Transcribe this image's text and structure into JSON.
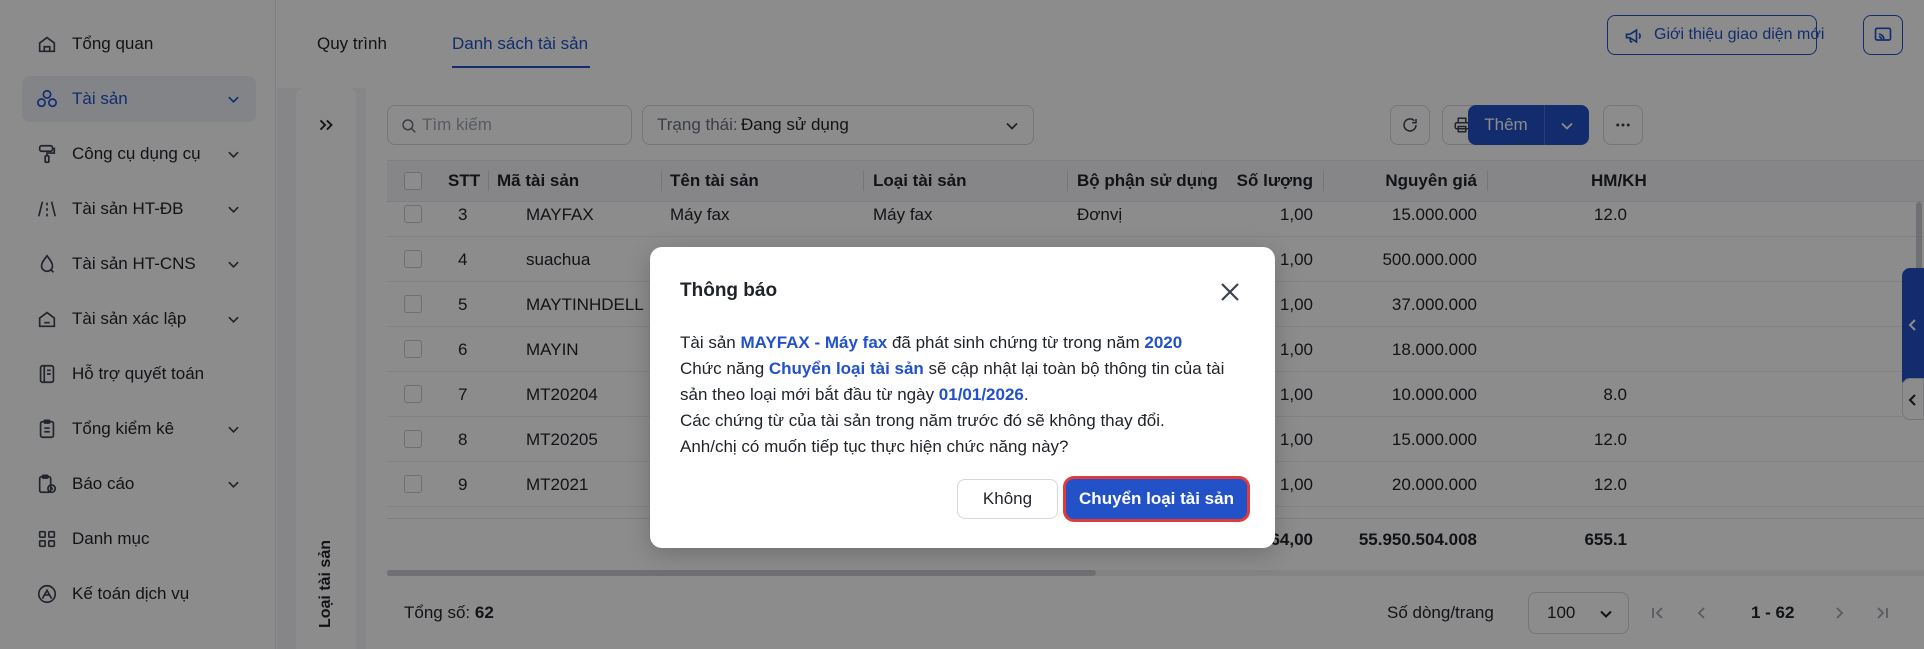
{
  "sidebar": {
    "items": [
      {
        "label": "Tổng quan",
        "icon": "home-icon",
        "has_chevron": false,
        "active": false
      },
      {
        "label": "Tài sản",
        "icon": "assets-icon",
        "has_chevron": true,
        "active": true
      },
      {
        "label": "Công cụ dụng cụ",
        "icon": "paint-roller-icon",
        "has_chevron": true,
        "active": false
      },
      {
        "label": "Tài sản HT-ĐB",
        "icon": "road-icon",
        "has_chevron": true,
        "active": false
      },
      {
        "label": "Tài sản HT-CNS",
        "icon": "water-drop-icon",
        "has_chevron": true,
        "active": false
      },
      {
        "label": "Tài sản xác lập",
        "icon": "home-outline-icon",
        "has_chevron": true,
        "active": false
      },
      {
        "label": "Hỗ trợ quyết toán",
        "icon": "ledger-icon",
        "has_chevron": false,
        "active": false
      },
      {
        "label": "Tổng kiểm kê",
        "icon": "clipboard-icon",
        "has_chevron": true,
        "active": false
      },
      {
        "label": "Báo cáo",
        "icon": "report-icon",
        "has_chevron": true,
        "active": false
      },
      {
        "label": "Danh mục",
        "icon": "grid-icon",
        "has_chevron": false,
        "active": false
      },
      {
        "label": "Kế toán dịch vụ",
        "icon": "accounting-logo-icon",
        "has_chevron": false,
        "active": false
      }
    ]
  },
  "topbar": {
    "tabs": [
      {
        "label": "Quy trình",
        "active": false
      },
      {
        "label": "Danh sách tài sản",
        "active": true
      }
    ],
    "intro_button": "Giới thiệu giao diện mới"
  },
  "left_panel": {
    "label": "Loại tài sản"
  },
  "toolbar": {
    "search_placeholder": "Tìm kiếm",
    "status_label": "Trạng thái:",
    "status_value": "Đang sử dụng",
    "add_label": "Thêm"
  },
  "table": {
    "columns": [
      "STT",
      "Mã tài sản",
      "Tên tài sản",
      "Loại tài sản",
      "Bộ phận sử dụng",
      "Số lượng",
      "Nguyên giá",
      "HM/KH"
    ],
    "rows": [
      {
        "stt": "3",
        "code": "MAYFAX",
        "name": "Máy fax",
        "type": "Máy fax",
        "dept": "Đơnvị",
        "qty": "1,00",
        "price": "15.000.000",
        "hm": "12.0"
      },
      {
        "stt": "4",
        "code": "suachua",
        "name": "",
        "type": "",
        "dept": "",
        "qty": "1,00",
        "price": "500.000.000",
        "hm": ""
      },
      {
        "stt": "5",
        "code": "MAYTINHDELL",
        "name": "",
        "type": "",
        "dept": "",
        "qty": "1,00",
        "price": "37.000.000",
        "hm": ""
      },
      {
        "stt": "6",
        "code": "MAYIN",
        "name": "",
        "type": "",
        "dept": "",
        "qty": "1,00",
        "price": "18.000.000",
        "hm": ""
      },
      {
        "stt": "7",
        "code": "MT20204",
        "name": "",
        "type": "",
        "dept": "",
        "qty": "1,00",
        "price": "10.000.000",
        "hm": "8.0"
      },
      {
        "stt": "8",
        "code": "MT20205",
        "name": "",
        "type": "",
        "dept": "",
        "qty": "1,00",
        "price": "15.000.000",
        "hm": "12.0"
      },
      {
        "stt": "9",
        "code": "MT2021",
        "name": "",
        "type": "",
        "dept": "",
        "qty": "1,00",
        "price": "20.000.000",
        "hm": "12.0"
      }
    ],
    "footer": {
      "qty": "64,00",
      "price": "55.950.504.008",
      "hm": "655.1"
    }
  },
  "pager": {
    "total_label": "Tổng số:",
    "total_value": "62",
    "rows_per_page_label": "Số dòng/trang",
    "rows_per_page_value": "100",
    "range": "1 - 62"
  },
  "modal": {
    "title": "Thông báo",
    "t1": "Tài sản ",
    "asset": "MAYFAX - Máy fax",
    "t2": " đã phát sinh chứng từ trong năm ",
    "year": "2020",
    "t3": "Chức năng ",
    "function_name": "Chuyển loại tài sản",
    "t4": " sẽ cập nhật lại toàn bộ thông tin của tài sản theo loại mới bắt đầu từ ngày ",
    "date": "01/01/2026",
    "t5": ".",
    "line3": "Các chứng từ của tài sản trong năm trước đó sẽ không thay đổi.",
    "line4": "Anh/chị có muốn tiếp tục thực hiện chức năng này?",
    "cancel_label": "Không",
    "confirm_label": "Chuyển loại tài sản"
  },
  "colors": {
    "accent": "#2351c8",
    "highlight_border": "#e03a3a"
  }
}
